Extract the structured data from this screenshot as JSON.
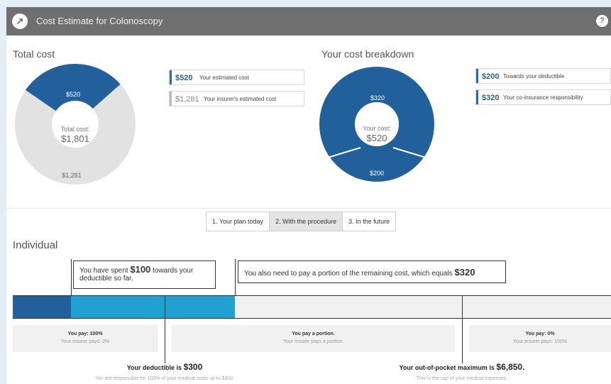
{
  "header": {
    "title": "Cost Estimate for Colonoscopy",
    "logo_glyph": "↗",
    "help_glyph": "?"
  },
  "total": {
    "section_title": "Total cost",
    "center_label": "Total cost:",
    "center_value": "$1,801",
    "slice_you": "$520",
    "slice_insurer": "$1,281",
    "legend": [
      {
        "amount": "$520",
        "text": "Your estimated cost"
      },
      {
        "amount": "$1,281",
        "text": "Your insurer's estimated cost"
      }
    ]
  },
  "breakdown": {
    "section_title": "Your cost breakdown",
    "center_label": "Your cost:",
    "center_value": "$520",
    "slice_top": "$320",
    "slice_bottom": "$200",
    "legend": [
      {
        "amount": "$200",
        "text": "Towards your deductible"
      },
      {
        "amount": "$320",
        "text": "Your co-insurance responsibility"
      }
    ]
  },
  "tabs": [
    "1. Your plan today",
    "2. With the procedure",
    "3. In the future"
  ],
  "active_tab": 1,
  "individual": {
    "title": "Individual",
    "callout_spent": {
      "pre": "You have spent ",
      "amount": "$100",
      "post": " towards your deductible so far."
    },
    "callout_portion": {
      "pre": "You also need to pay a portion of the remaining cost, which equals ",
      "amount": "$320"
    },
    "labels": [
      {
        "a": "You pay: 100%",
        "b": "Your insurer pays: 0%"
      },
      {
        "a": "You pay a portion.",
        "b": "Your insurer pays a portion."
      },
      {
        "a": "You pay: 0%",
        "b": "Your insurer pays: 100%"
      }
    ],
    "deductible": {
      "pre": "Your deductible is ",
      "amount": "$300",
      "note": "You are responsible for 100% of your medical costs up to $300."
    },
    "oop": {
      "pre": "Your out-of-pocket maximum is ",
      "amount": "$6,850.",
      "note": "This is the cap of your medical expenses."
    }
  },
  "colors": {
    "dark_blue": "#22609c",
    "light_blue": "#1fa1d1",
    "grey": "#e2e2e2",
    "header": "#6f6f6f"
  }
}
